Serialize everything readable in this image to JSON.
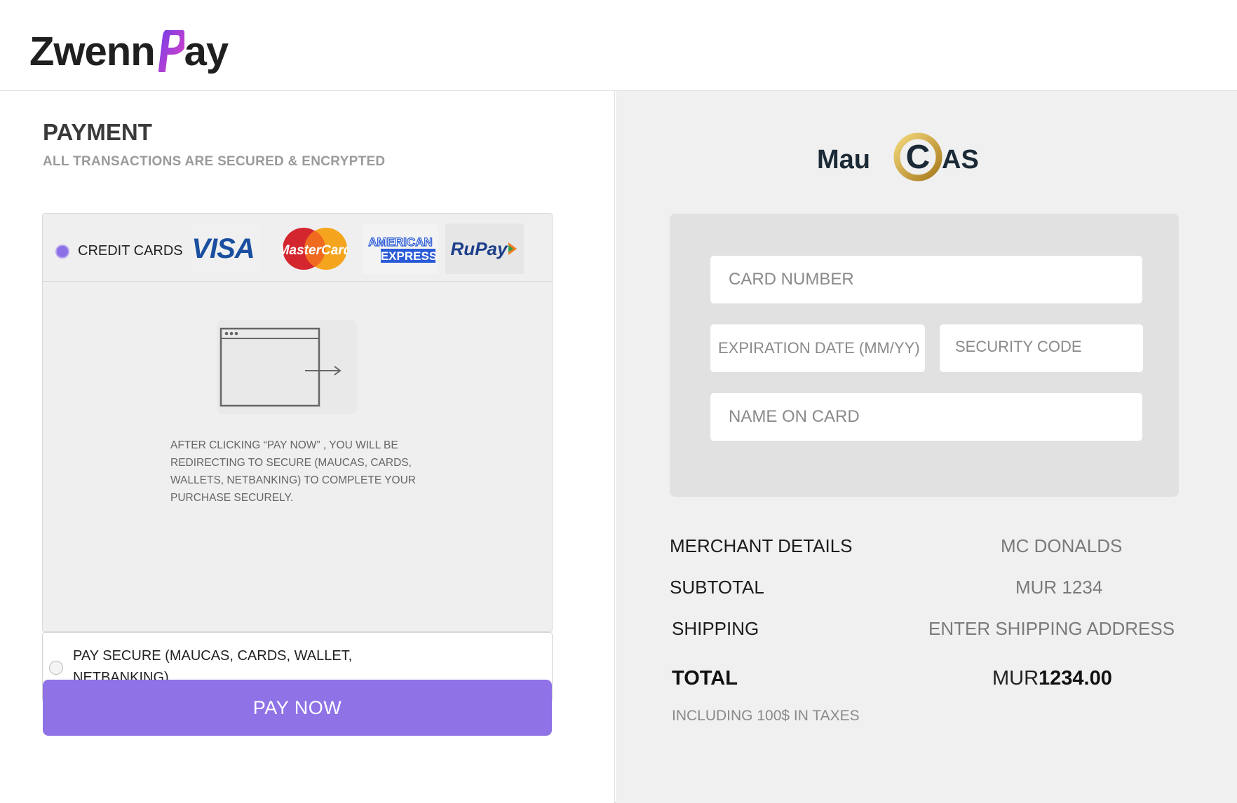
{
  "brand": {
    "name_part1": "Zwenn",
    "name_part2": "ay",
    "accent_colors": [
      "#7b3fe4",
      "#e040c8"
    ]
  },
  "payment": {
    "title": "PAYMENT",
    "subtitle": "ALL TRANSACTIONS ARE SECURED & ENCRYPTED",
    "credit_cards": {
      "label": "CREDIT CARDS",
      "selected": true,
      "logos": [
        {
          "name": "visa-logo",
          "text": "VISA"
        },
        {
          "name": "mastercard-logo",
          "text": "MasterCard"
        },
        {
          "name": "amex-logo",
          "text_top": "AMERICAN",
          "text_bottom": "EXPRESS"
        },
        {
          "name": "rupay-logo",
          "text": "RuPay"
        }
      ],
      "redirect_note": "AFTER CLICKING “PAY NOW” , YOU WILL BE REDIRECTING TO SECURE (MAUCAS, CARDS, WALLETS, NETBANKING) TO COMPLETE YOUR PURCHASE SECURELY."
    },
    "pay_secure": {
      "label": "PAY SECURE (MAUCAS, CARDS, WALLET, NETBANKING)",
      "selected": false
    },
    "pay_button": "PAY NOW",
    "accent_color": "#8e72e6"
  },
  "maucas": {
    "logo_text_left": "Mau",
    "logo_text_right": "AS",
    "logo_mark": "C"
  },
  "card_form": {
    "card_number_placeholder": "CARD NUMBER",
    "expiration_placeholder": "EXPIRATION DATE (MM/YY)",
    "security_placeholder": "SECURITY CODE",
    "name_placeholder": "NAME ON CARD"
  },
  "summary": {
    "merchant_label": "MERCHANT DETAILS",
    "merchant_value": "MC DONALDS",
    "subtotal_label": "SUBTOTAL",
    "subtotal_value": "MUR 1234",
    "shipping_label": "SHIPPING",
    "shipping_value": "ENTER SHIPPING ADDRESS",
    "total_label": "TOTAL",
    "total_currency": "MUR",
    "total_amount": "1234.00",
    "tax_note": "INCLUDING 100$ IN TAXES"
  }
}
